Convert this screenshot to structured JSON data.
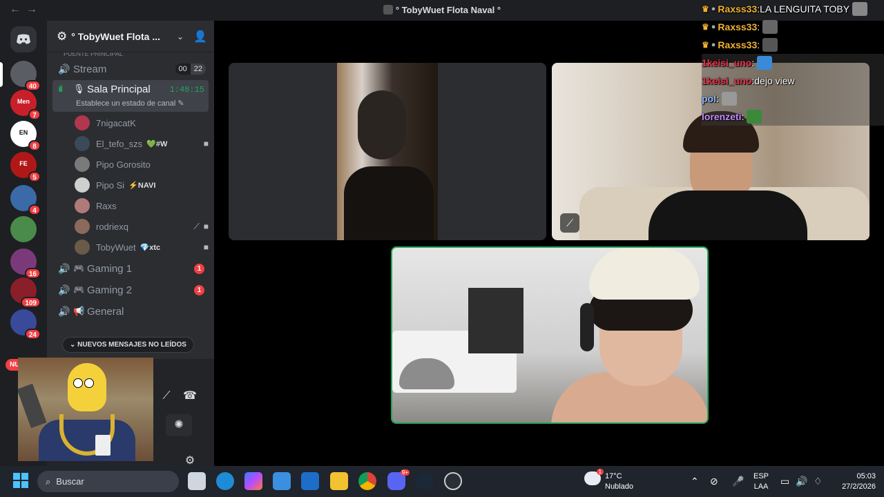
{
  "titlebar": {
    "back": "←",
    "forward": "→",
    "title": "° TobyWuet Flota Naval °"
  },
  "rail": {
    "servers": [
      {
        "badge": "40",
        "color": "#5a5d63"
      },
      {
        "badge": "7",
        "color": "#c8202a",
        "text": "Men"
      },
      {
        "badge": "8",
        "color": "#ffffff",
        "text": "EN"
      },
      {
        "badge": "5",
        "color": "#b01818",
        "text": "FE"
      },
      {
        "badge": "4",
        "color": "#3a6aa8"
      },
      {
        "badge": "",
        "color": "#4a8a4a"
      },
      {
        "badge": "16",
        "color": "#7a3a7a"
      },
      {
        "badge": "109",
        "color": "#8a1f2a"
      },
      {
        "badge": "24",
        "color": "#3a4a9a"
      }
    ],
    "new_label": "NUEVO"
  },
  "sidebar": {
    "server_name": "° TobyWuet Flota ...",
    "category_cut": "PUENTE PRINCIPAL",
    "stream": {
      "label": "Stream",
      "count_current": "00",
      "count_limit": "22"
    },
    "sala": {
      "label": "Sala Principal",
      "timer": "1:48:15",
      "status": "Establece un estado de canal"
    },
    "users": [
      {
        "name": "7nigacatK",
        "tag": "",
        "color": "#b0374e"
      },
      {
        "name": "El_tefo_szs",
        "tag": "#W",
        "tag_prefix": "💚",
        "color": "#3a4a5a"
      },
      {
        "name": "Pipo Gorosito",
        "tag": "",
        "color": "#7a7a7a"
      },
      {
        "name": "Pipo Si",
        "tag": "NAVI",
        "tag_prefix": "⚡",
        "color": "#cfcfcf"
      },
      {
        "name": "Raxs",
        "tag": "",
        "color": "#b07a7a"
      },
      {
        "name": "rodriexq",
        "tag": "",
        "color": "#8a6a5a"
      },
      {
        "name": "TobyWuet",
        "tag": "xtc",
        "tag_prefix": "💎",
        "color": "#6a5a4a"
      }
    ],
    "channels": [
      {
        "label": "Gaming 1",
        "emoji": "🎮",
        "badge": "1"
      },
      {
        "label": "Gaming 2",
        "emoji": "🎮",
        "badge": "1"
      },
      {
        "label": "General",
        "emoji": "📢",
        "badge": ""
      }
    ],
    "unread_label": "NUEVOS MENSAJES NO LEÍDOS"
  },
  "chat": [
    {
      "user": "Raxss33",
      "color": "#f0b232",
      "text": "LA LENGUITA TOBY",
      "crown": true
    },
    {
      "user": "Raxss33",
      "color": "#f0b232",
      "text": "",
      "crown": true
    },
    {
      "user": "Raxss33",
      "color": "#f0b232",
      "text": "",
      "crown": true
    },
    {
      "user": "1keisi_uno",
      "color": "#e8304a",
      "text": "",
      "crown": false
    },
    {
      "user": "1keisi_uno",
      "color": "#e8304a",
      "text": "dejo view",
      "crown": false
    },
    {
      "user": "pol",
      "color": "#8cb4ff",
      "text": "",
      "crown": false
    },
    {
      "user": "lorenzeti",
      "color": "#c58cff",
      "text": "",
      "crown": false
    }
  ],
  "taskbar": {
    "search_placeholder": "Buscar",
    "weather_temp": "17°C",
    "weather_desc": "Nublado",
    "weather_badge": "1",
    "lang1": "ESP",
    "lang2": "LAA",
    "time": "05:03",
    "date": "27/2/2026",
    "discord_badge": "9+"
  }
}
